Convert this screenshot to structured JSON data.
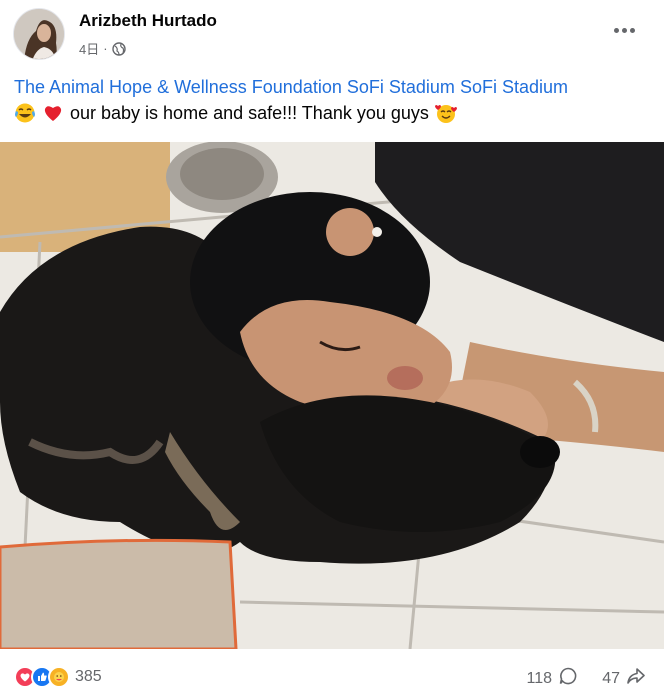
{
  "post": {
    "author": "Arizbeth Hurtado",
    "time": "4日",
    "separator": "·",
    "privacy_icon": "globe-icon",
    "more_icon": "more-options-icon"
  },
  "text": {
    "tags": [
      "The Animal Hope & Wellness Foundation",
      "SoFi Stadium",
      "SoFi Stadium"
    ],
    "emojis": [
      "tears-of-joy-emoji",
      "red-heart-emoji"
    ],
    "message": "our baby is home and safe!!! Thank you guys",
    "trailing_emoji": "smiling-face-with-hearts-emoji"
  },
  "photo": {
    "subject_icon": "photo-woman-hugging-dog"
  },
  "footer": {
    "reaction_icons": [
      "love-reaction-icon",
      "like-reaction-icon",
      "care-reaction-icon"
    ],
    "reaction_count": "385",
    "comment_count": "118",
    "comment_icon": "comment-icon",
    "share_count": "47",
    "share_icon": "share-icon"
  },
  "colors": {
    "link": "#216fdb",
    "secondary_text": "#65676b",
    "like_blue": "#1877f2",
    "love_red": "#f33e58",
    "care_yellow": "#f7b125"
  }
}
